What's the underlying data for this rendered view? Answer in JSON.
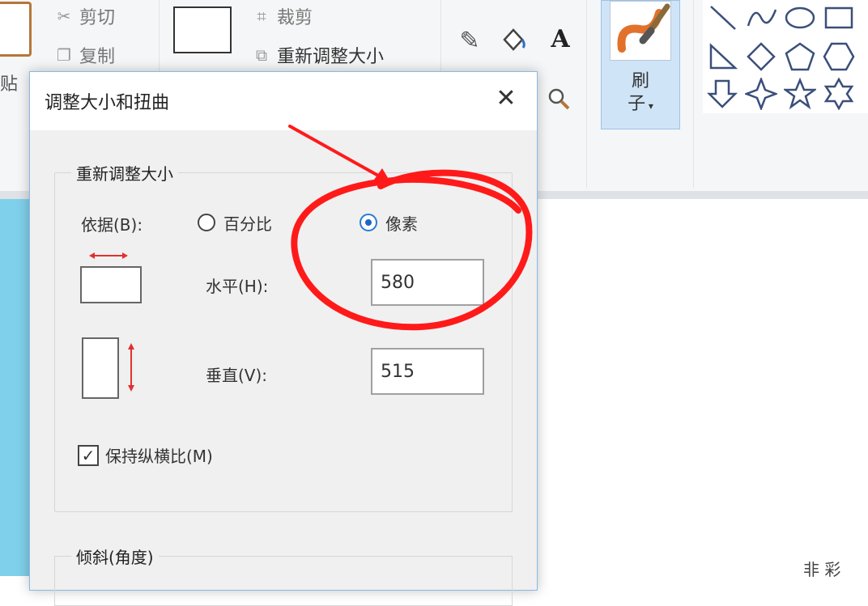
{
  "ribbon": {
    "cut_label": "剪切",
    "copy_label": "复制",
    "crop_label": "裁剪",
    "resize_label": "重新调整大小",
    "paste_fragment": "贴",
    "brush_label_top": "刷",
    "brush_label_bottom": "子",
    "text_tool": "A"
  },
  "dialog": {
    "title": "调整大小和扭曲",
    "close_glyph": "✕",
    "resize_group": {
      "legend": "重新调整大小",
      "by_label": "依据(B):",
      "option_percent": "百分比",
      "option_pixels": "像素",
      "selected": "pixels",
      "horizontal_label": "水平(H):",
      "horizontal_value": "580",
      "vertical_label": "垂直(V):",
      "vertical_value": "515",
      "keep_ratio_label": "保持纵横比(M)",
      "keep_ratio_checked": true
    },
    "skew_group": {
      "legend": "倾斜(角度)"
    }
  },
  "status_fragment": "非 彩",
  "colors": {
    "accent": "#1f66c2",
    "annotation": "#ff1a1a",
    "left_strip": "#7fd0ea"
  }
}
